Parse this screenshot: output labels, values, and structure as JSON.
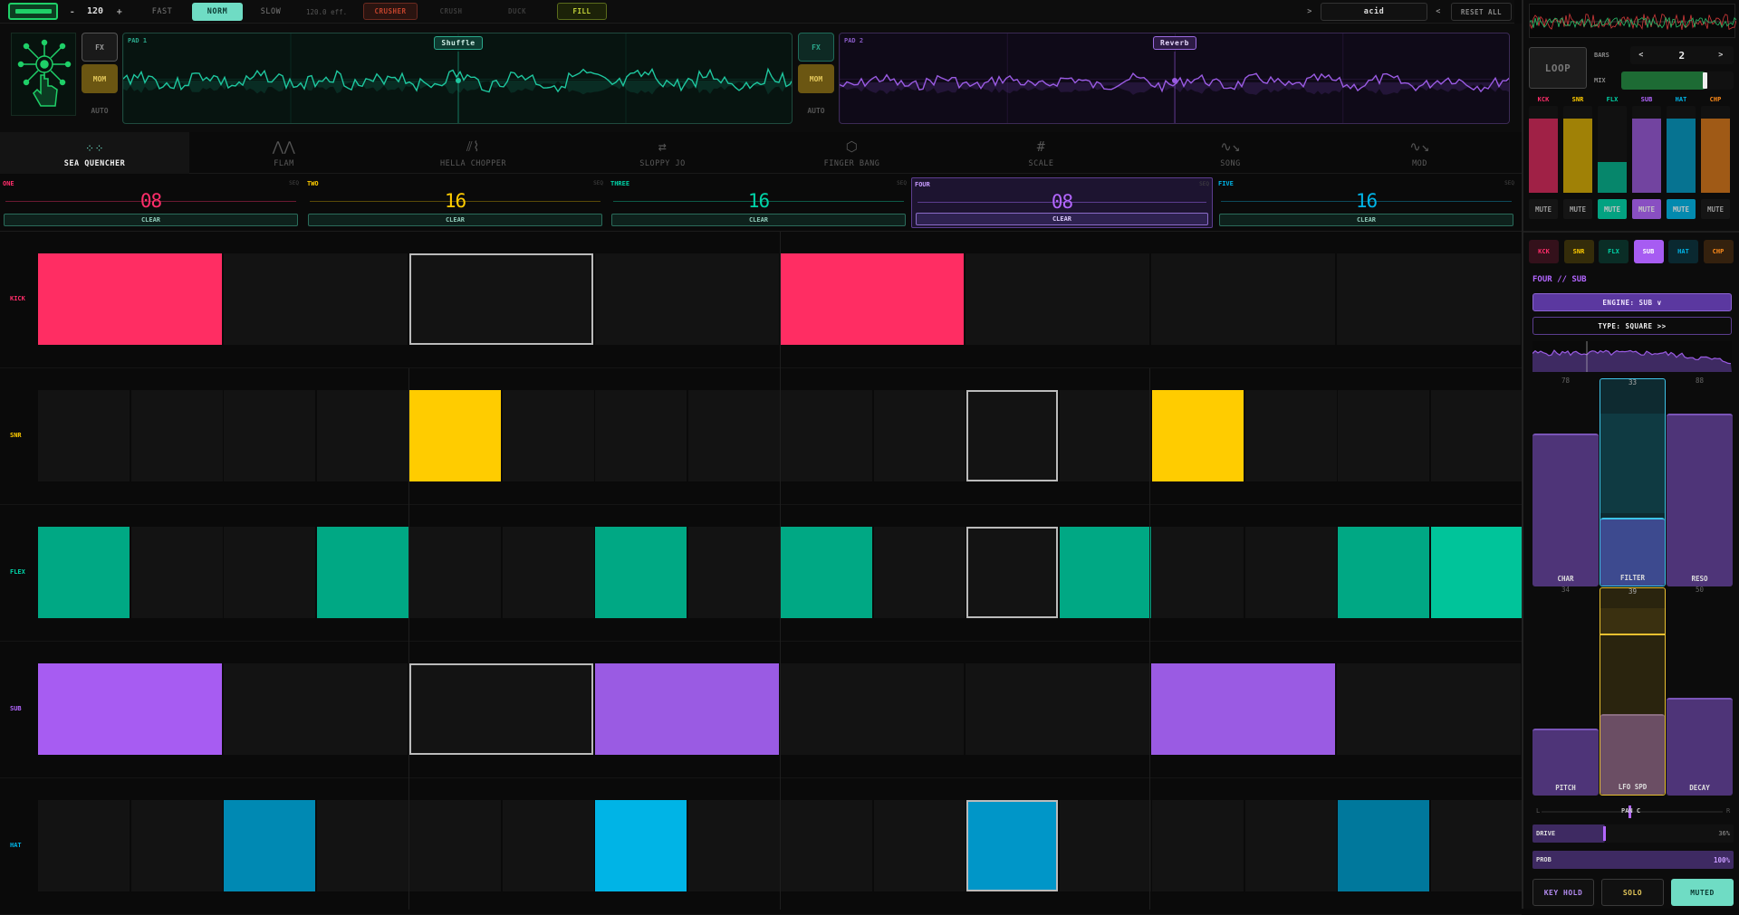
{
  "transport": {
    "bpm": "120",
    "minus": "-",
    "plus": "+",
    "speeds": [
      "FAST",
      "NORM",
      "SLOW"
    ],
    "eff": "120.0 eff.",
    "crusher": "CRUSHER",
    "crush": "CRUSH",
    "duck": "DUCK",
    "fill": "FILL",
    "prev": ">",
    "preset": "acid",
    "next": "<",
    "reset": "RESET ALL"
  },
  "pads": {
    "fx": "FX",
    "mom": "MOM",
    "auto": "AUTO",
    "pad1": {
      "label": "PAD 1",
      "effect": "Shuffle"
    },
    "pad2": {
      "label": "PAD 2",
      "effect": "Reverb"
    }
  },
  "tabs": [
    {
      "label": "SEA QUENCHER",
      "icon": "grid-icon"
    },
    {
      "label": "FLAM",
      "icon": "flam-icon"
    },
    {
      "label": "HELLA CHOPPER",
      "icon": "chopper-icon"
    },
    {
      "label": "SLOPPY JO",
      "icon": "shuffle-icon"
    },
    {
      "label": "FINGER BANG",
      "icon": "hexagon-icon"
    },
    {
      "label": "SCALE",
      "icon": "hash-icon"
    },
    {
      "label": "SONG",
      "icon": "song-icon"
    },
    {
      "label": "MOD",
      "icon": "mod-icon"
    }
  ],
  "sequences": [
    {
      "name": "ONE",
      "sq": "SEQ",
      "steps": "08",
      "clear": "CLEAR",
      "color": "#ff2d6a"
    },
    {
      "name": "TWO",
      "sq": "SEQ",
      "steps": "16",
      "clear": "CLEAR",
      "color": "#ffcc00"
    },
    {
      "name": "THREE",
      "sq": "SEQ",
      "steps": "16",
      "clear": "CLEAR",
      "color": "#00d4a8"
    },
    {
      "name": "FOUR",
      "sq": "SEQ",
      "steps": "08",
      "clear": "CLEAR",
      "color": "#b366ff"
    },
    {
      "name": "FIVE",
      "sq": "SEQ",
      "steps": "16",
      "clear": "CLEAR",
      "color": "#00b4e6"
    }
  ],
  "tracks": [
    {
      "label": "KICK",
      "color": "#ff2d6a"
    },
    {
      "label": "SNR",
      "color": "#ffcc00"
    },
    {
      "label": "FLEX",
      "color": "#00d4a8"
    },
    {
      "label": "SUB",
      "color": "#b366ff"
    },
    {
      "label": "HAT",
      "color": "#00b4e6"
    }
  ],
  "right": {
    "loop": "LOOP",
    "bars_label": "BARS",
    "bars_prev": "<",
    "bars_value": "2",
    "bars_next": ">",
    "mix_label": "MIX",
    "mix_level": 0.75,
    "channels": [
      {
        "label": "KCK",
        "color": "#ff2d6a",
        "level": 0.85,
        "mute": "MUTE",
        "muted": false
      },
      {
        "label": "SNR",
        "color": "#ffcc00",
        "level": 0.85,
        "mute": "MUTE",
        "muted": false
      },
      {
        "label": "FLX",
        "color": "#00d4a8",
        "level": 0.35,
        "mute": "MUTE",
        "muted": true
      },
      {
        "label": "SUB",
        "color": "#b366ff",
        "level": 0.85,
        "mute": "MUTE",
        "muted": true
      },
      {
        "label": "HAT",
        "color": "#00b4e6",
        "level": 0.85,
        "mute": "MUTE",
        "muted": true
      },
      {
        "label": "CHP",
        "color": "#ff8c1a",
        "level": 0.85,
        "mute": "MUTE",
        "muted": false
      }
    ],
    "track_buttons": [
      "KCK",
      "SNR",
      "FLX",
      "SUB",
      "HAT",
      "CHP"
    ],
    "title": "FOUR // SUB",
    "engine": "ENGINE: SUB  v",
    "type": "TYPE: SQUARE  >>",
    "sliders_top": [
      {
        "label": "CHAR",
        "value": "78",
        "level": 0.78
      },
      {
        "label": "FILTER",
        "value": "33",
        "level": 0.33
      },
      {
        "label": "RESO",
        "value": "88",
        "level": 0.88
      }
    ],
    "sliders_bottom": [
      {
        "label": "PITCH",
        "value": "34",
        "level": 0.34
      },
      {
        "label": "LFO SPD",
        "value": "39",
        "level": 0.39
      },
      {
        "label": "DECAY",
        "value": "50",
        "level": 0.5
      }
    ],
    "pan_l": "L",
    "pan_label": "PAN C",
    "pan_r": "R",
    "drive_label": "DRIVE",
    "drive_value": "36%",
    "drive_level": 0.36,
    "prob_label": "PROB",
    "prob_value": "100%",
    "prob_level": 1.0,
    "keyhold": "KEY HOLD",
    "solo": "SOLO",
    "muted": "MUTED"
  }
}
